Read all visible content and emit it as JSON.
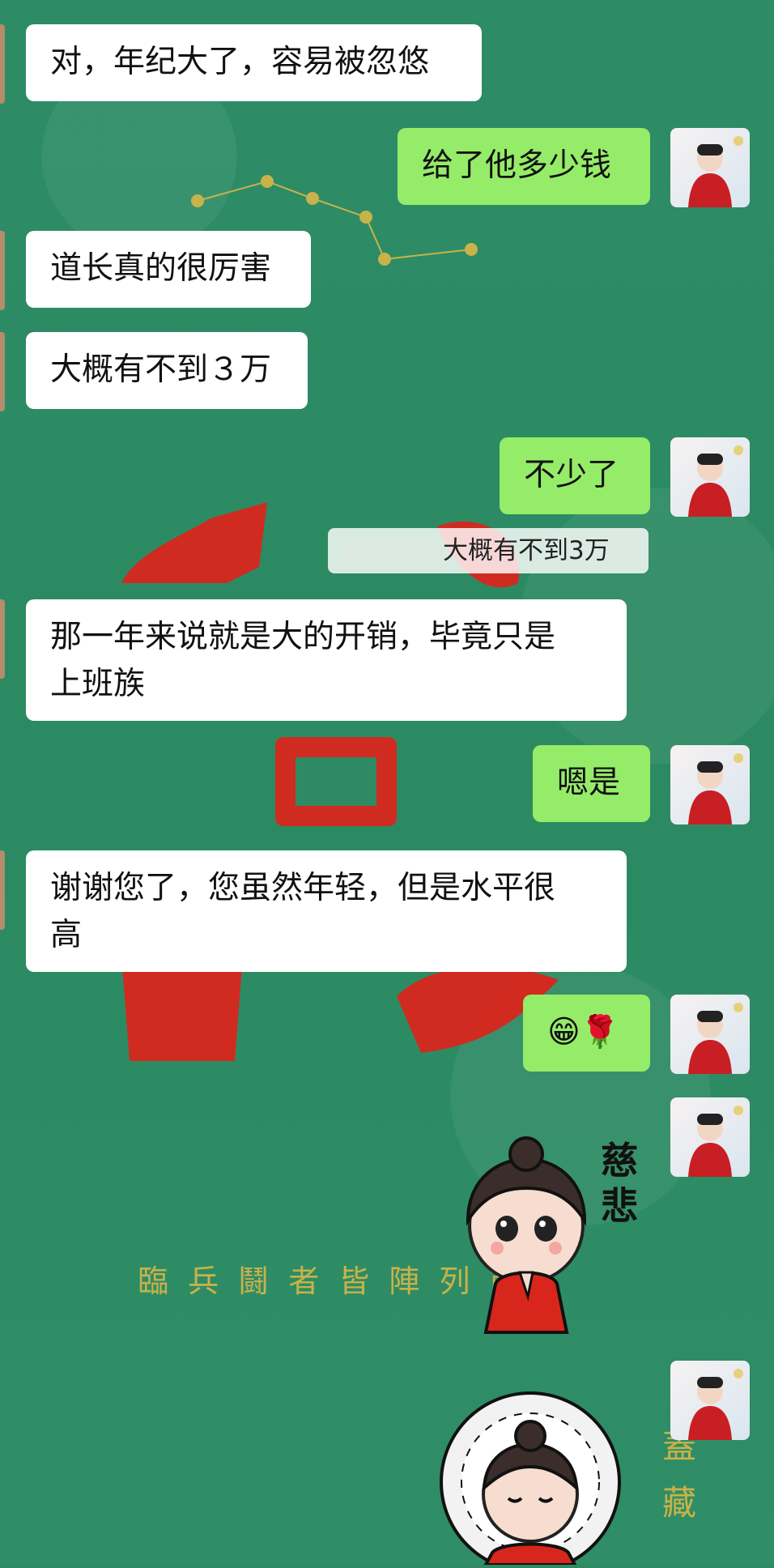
{
  "messages": [
    {
      "side": "in",
      "text": "对，年纪大了，容易被忽悠"
    },
    {
      "side": "out",
      "text": "给了他多少钱"
    },
    {
      "side": "in",
      "text": "道长真的很厉害"
    },
    {
      "side": "in",
      "text": "大概有不到３万"
    },
    {
      "side": "out",
      "text": "不少了"
    },
    {
      "side": "in",
      "line1": "那一年来说就是大的开销，毕竟只是",
      "line2": "上班族"
    },
    {
      "side": "out",
      "text": "嗯是"
    },
    {
      "side": "in",
      "line1": "谢谢您了，您虽然年轻，但是水平很",
      "line2": "高"
    },
    {
      "side": "out",
      "text": "😁🌹"
    }
  ],
  "quote": {
    "text": "大概有不到3万"
  },
  "background": {
    "verse": "臨 兵 鬪 者 皆 陣 列 前",
    "corner_text": "蓋 藏"
  },
  "stickers": [
    {
      "caption_line1": "慈",
      "caption_line2": "悲"
    }
  ],
  "colors": {
    "incoming": "#ffffff",
    "outgoing": "#95ec69",
    "background": "#2f8a63"
  }
}
